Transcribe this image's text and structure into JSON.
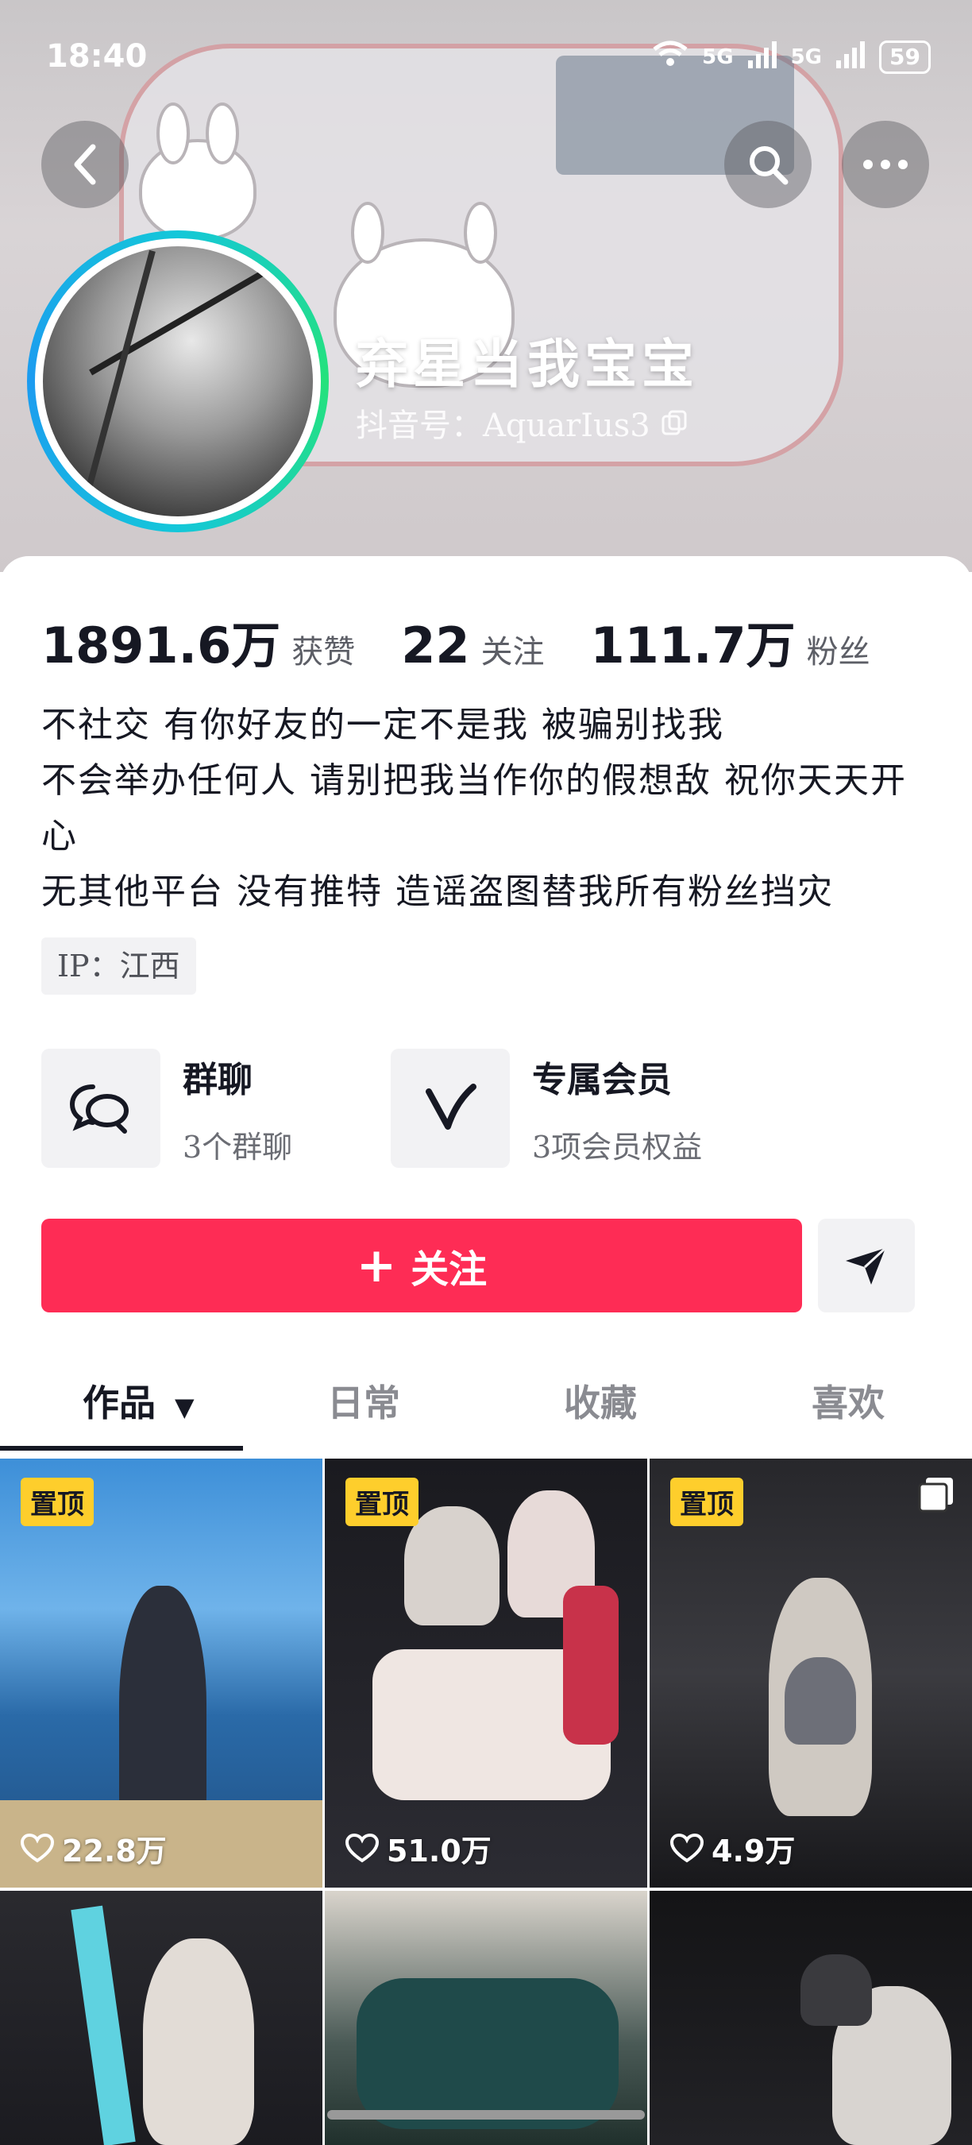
{
  "status_bar": {
    "time": "18:40",
    "signal_1": "5G",
    "signal_2": "5G",
    "battery": "59"
  },
  "profile": {
    "nickname": "弃星当我宝宝",
    "douyin_id": "抖音号：AquarIus3",
    "stats": [
      {
        "value": "1891.6万",
        "label": "获赞"
      },
      {
        "value": "22",
        "label": "关注"
      },
      {
        "value": "111.7万",
        "label": "粉丝"
      }
    ],
    "bio_lines": [
      "不社交 有你好友的一定不是我 被骗别找我",
      "不会举办任何人 请别把我当作你的假想敌 祝你天天开心",
      "无其他平台 没有推特 造谣盗图替我所有粉丝挡灾"
    ],
    "ip": "IP：江西"
  },
  "features": {
    "group_chat": {
      "title": "群聊",
      "subtitle": "3个群聊",
      "icon": "chat-bubbles-icon"
    },
    "membership": {
      "title": "专属会员",
      "subtitle": "3项会员权益",
      "icon": "v-icon"
    }
  },
  "actions": {
    "follow_label": "关注",
    "follow_plus": "+"
  },
  "tabs": [
    {
      "label": "作品",
      "active": true
    },
    {
      "label": "日常",
      "active": false
    },
    {
      "label": "收藏",
      "active": false
    },
    {
      "label": "喜欢",
      "active": false
    }
  ],
  "works": [
    {
      "pinned": true,
      "pin_label": "置顶",
      "likes": "22.8万"
    },
    {
      "pinned": true,
      "pin_label": "置顶",
      "likes": "51.0万"
    },
    {
      "pinned": true,
      "pin_label": "置顶",
      "likes": "4.9万"
    },
    {
      "pinned": false
    },
    {
      "pinned": false
    },
    {
      "pinned": false
    }
  ],
  "colors": {
    "accent": "#fe2c55",
    "pin": "#fece2c",
    "avatar_ring": "#14c7d9"
  }
}
